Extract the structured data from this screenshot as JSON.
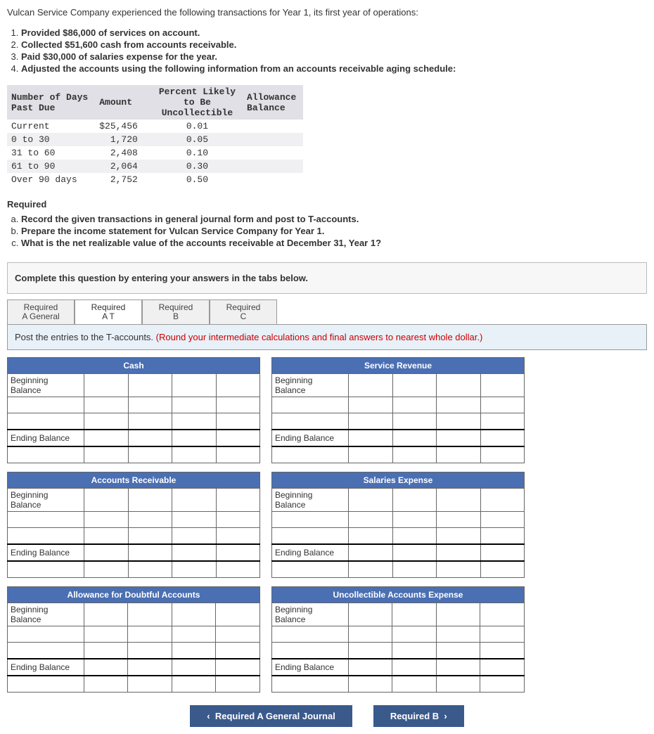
{
  "intro": "Vulcan Service Company experienced the following transactions for Year 1, its first year of operations:",
  "transactions": [
    "Provided $86,000 of services on account.",
    "Collected $51,600 cash from accounts receivable.",
    "Paid $30,000 of salaries expense for the year.",
    "Adjusted the accounts using the following information from an accounts receivable aging schedule:"
  ],
  "aging": {
    "headers": {
      "days": "Number of Days\nPast Due",
      "amount": "Amount",
      "percent": "Percent Likely\nto Be\nUncollectible",
      "allowance": "Allowance\nBalance"
    },
    "rows": [
      {
        "days": "Current",
        "amount": "$25,456",
        "pct": "0.01",
        "allow": ""
      },
      {
        "days": "0 to 30",
        "amount": "1,720",
        "pct": "0.05",
        "allow": ""
      },
      {
        "days": "31 to 60",
        "amount": "2,408",
        "pct": "0.10",
        "allow": ""
      },
      {
        "days": "61 to 90",
        "amount": "2,064",
        "pct": "0.30",
        "allow": ""
      },
      {
        "days": "Over 90 days",
        "amount": "2,752",
        "pct": "0.50",
        "allow": ""
      }
    ]
  },
  "required_heading": "Required",
  "required_items": [
    "Record the given transactions in general journal form and post to T-accounts.",
    "Prepare the income statement for Vulcan Service Company for Year 1.",
    "What is the net realizable value of the accounts receivable at December 31, Year 1?"
  ],
  "answer_box": "Complete this question by entering your answers in the tabs below.",
  "tabs": [
    {
      "line1": "Required",
      "line2": "A General"
    },
    {
      "line1": "Required",
      "line2": "A T"
    },
    {
      "line1": "Required",
      "line2": "B"
    },
    {
      "line1": "Required",
      "line2": "C"
    }
  ],
  "instruction": {
    "black": "Post the entries to the T-accounts. ",
    "red": "(Round your intermediate calculations and final answers to nearest whole dollar.)"
  },
  "t_accounts": {
    "left": [
      {
        "title": "Cash",
        "rows": [
          "Beginning Balance",
          "",
          "",
          "Ending Balance",
          ""
        ]
      },
      {
        "title": "Accounts Receivable",
        "rows": [
          "Beginning Balance",
          "",
          "",
          "Ending Balance",
          ""
        ]
      },
      {
        "title": "Allowance for Doubtful Accounts",
        "rows": [
          "Beginning Balance",
          "",
          "",
          "Ending Balance",
          ""
        ]
      }
    ],
    "right": [
      {
        "title": "Service Revenue",
        "rows": [
          "Beginning Balance",
          "",
          "",
          "Ending Balance",
          ""
        ]
      },
      {
        "title": "Salaries Expense",
        "rows": [
          "Beginning Balance",
          "",
          "",
          "Ending Balance",
          ""
        ]
      },
      {
        "title": "Uncollectible Accounts Expense",
        "rows": [
          "Beginning Balance",
          "",
          "",
          "Ending Balance",
          ""
        ]
      }
    ]
  },
  "nav": {
    "prev": "Required A General Journal",
    "next": "Required B"
  }
}
